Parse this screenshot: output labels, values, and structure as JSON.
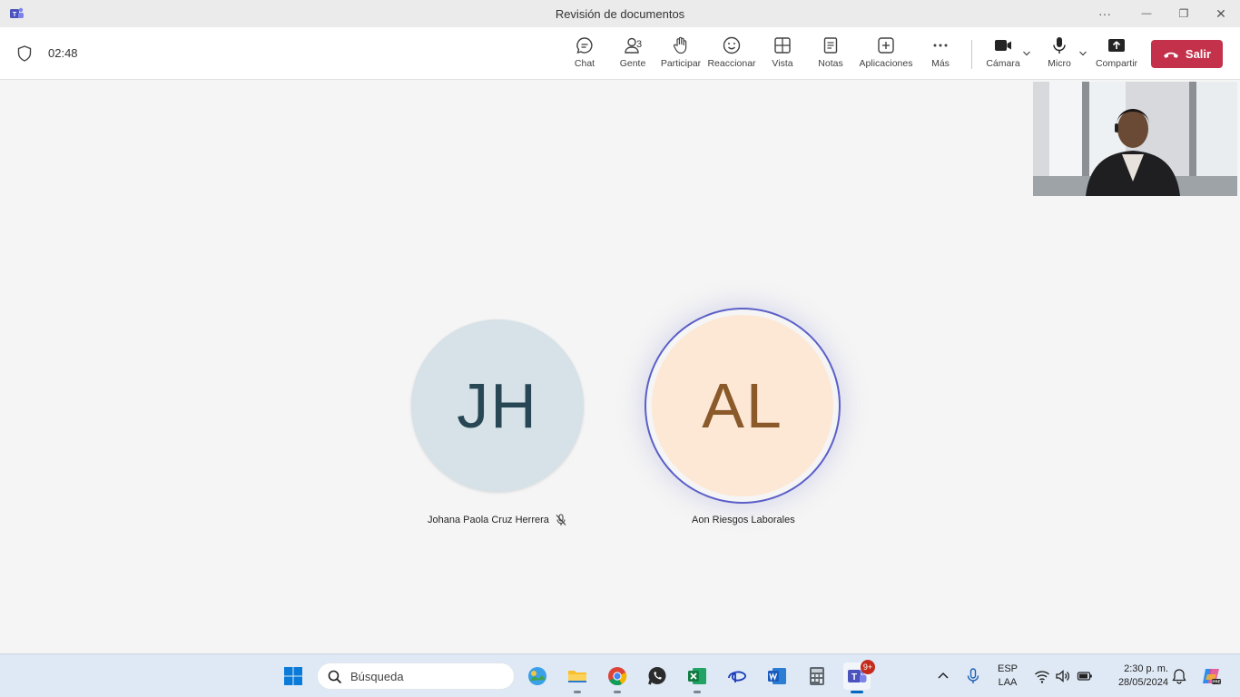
{
  "window": {
    "title": "Revisión de documentos",
    "controls": {
      "more": "···",
      "minimize": "—",
      "restore": "❐",
      "close": "✕"
    }
  },
  "toolbar": {
    "timer": "02:48",
    "buttons": [
      {
        "label": "Chat",
        "icon": "chat-icon"
      },
      {
        "label": "Gente",
        "icon": "people-icon",
        "count": "3"
      },
      {
        "label": "Participar",
        "icon": "raise-hand-icon"
      },
      {
        "label": "Reaccionar",
        "icon": "emoji-icon"
      },
      {
        "label": "Vista",
        "icon": "grid-view-icon"
      },
      {
        "label": "Notas",
        "icon": "notes-icon"
      },
      {
        "label": "Aplicaciones",
        "icon": "add-apps-icon"
      },
      {
        "label": "Más",
        "icon": "more-icon"
      },
      {
        "label": "Cámara",
        "icon": "camera-icon"
      },
      {
        "label": "Micro",
        "icon": "microphone-icon"
      },
      {
        "label": "Compartir",
        "icon": "share-icon"
      }
    ],
    "leave_label": "Salir"
  },
  "participants": [
    {
      "initials": "JH",
      "name": "Johana Paola Cruz Herrera",
      "muted": true,
      "avatar_bg": "#d6e2e8",
      "avatar_fg": "#284754"
    },
    {
      "initials": "AL",
      "name": "Aon Riesgos Laborales",
      "speaking": true,
      "avatar_bg": "#fde8d6",
      "avatar_fg": "#8a5a2a",
      "ring_color": "#5b5fc7"
    }
  ],
  "taskbar": {
    "search_placeholder": "Búsqueda",
    "apps": [
      "start-icon",
      "photos-icon",
      "file-explorer-icon",
      "chrome-icon",
      "whatsapp-icon",
      "excel-icon",
      "disney-plus-icon",
      "word-icon",
      "calculator-icon",
      "teams-icon"
    ],
    "teams_badge": "9+",
    "language_top": "ESP",
    "language_bottom": "LAA",
    "time": "2:30 p. m.",
    "date": "28/05/2024"
  },
  "colors": {
    "leave_button": "#c4314b",
    "accent": "#5b5fc7",
    "stage_bg": "#f5f5f5"
  }
}
